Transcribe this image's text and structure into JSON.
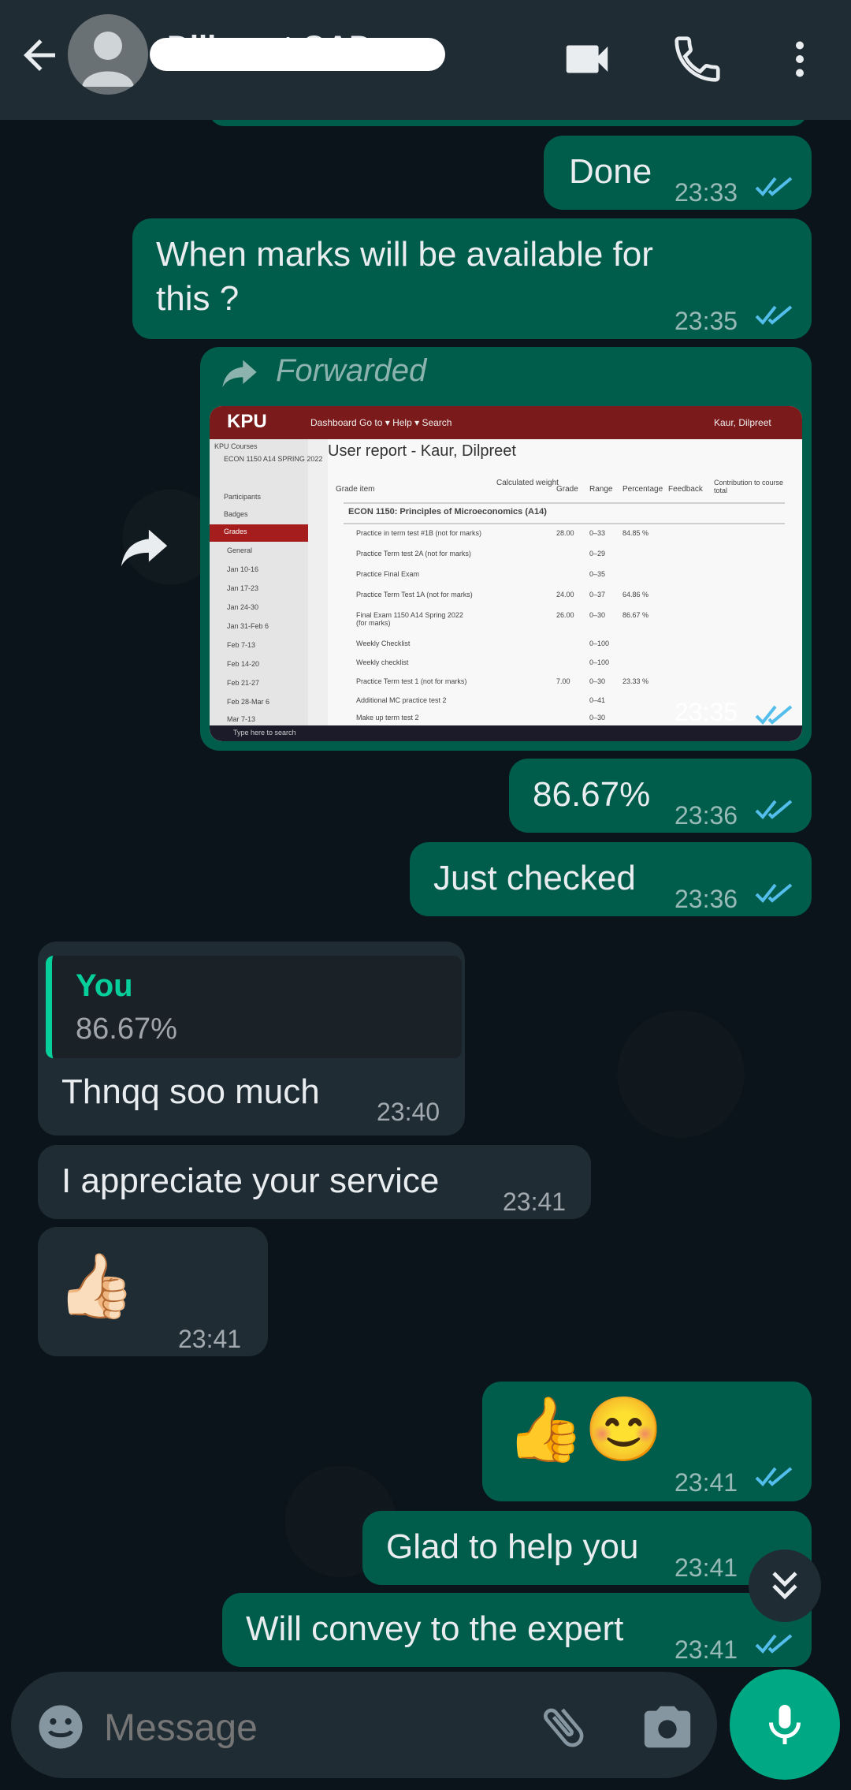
{
  "header": {
    "contact_name": "Diljpreet OAD"
  },
  "messages": [
    {
      "id": "m1",
      "dir": "out",
      "text": "Done",
      "time": "23:33",
      "read": true
    },
    {
      "id": "m2",
      "dir": "out",
      "text_line1": "When marks will be available for",
      "text_line2": "this ?",
      "time": "23:35",
      "read": true
    },
    {
      "id": "m3",
      "dir": "out",
      "type": "image",
      "forwarded_label": "Forwarded",
      "time": "23:35",
      "read": true,
      "image": {
        "brand": "KPU",
        "nav": "Dashboard  Go to ▾  Help ▾  Search",
        "user": "Kaur, Dilpreet",
        "title": "User report - Kaur, Dilpreet",
        "course": "ECON 1150: Principles of Microeconomics (A14)",
        "columns": [
          "Grade item",
          "Calculated weight",
          "Grade",
          "Range",
          "Percentage",
          "Feedback",
          "Contribution to course total"
        ],
        "rows": [
          {
            "item": "Practice in term test #1B (not for marks)",
            "grade": "28.00",
            "range": "0–33",
            "pct": "84.85 %"
          },
          {
            "item": "Practice Term test 2A (not for marks)",
            "grade": "",
            "range": "0–29",
            "pct": ""
          },
          {
            "item": "Practice Final Exam",
            "grade": "",
            "range": "0–35",
            "pct": ""
          },
          {
            "item": "Practice Term Test 1A (not for marks)",
            "grade": "24.00",
            "range": "0–37",
            "pct": "64.86 %"
          },
          {
            "item": "Final Exam 1150 A14 Spring 2022 (for marks)",
            "grade": "26.00",
            "range": "0–30",
            "pct": "86.67 %"
          },
          {
            "item": "Weekly Checklist",
            "grade": "",
            "range": "0–100",
            "pct": ""
          },
          {
            "item": "Weekly checklist",
            "grade": "",
            "range": "0–100",
            "pct": ""
          },
          {
            "item": "Practice Term test 1 (not for marks)",
            "grade": "7.00",
            "range": "0–30",
            "pct": "23.33 %"
          },
          {
            "item": "Additional MC practice test 2",
            "grade": "",
            "range": "0–41",
            "pct": ""
          },
          {
            "item": "Make up term test 2",
            "grade": "",
            "range": "0–30",
            "pct": ""
          }
        ],
        "sidebar": [
          "KPU Courses",
          "ECON 1150 A14 SPRING 2022",
          "Participants",
          "Badges",
          "Grades",
          "General",
          "Jan 10-16",
          "Jan 17-23",
          "Jan 24-30",
          "Jan 31-Feb 6",
          "Feb 7-13",
          "Feb 14-20",
          "Feb 21-27",
          "Feb 28-Mar 6",
          "Mar 7-13"
        ],
        "taskbar_search": "Type here to search"
      }
    },
    {
      "id": "m4",
      "dir": "out",
      "text": "86.67%",
      "time": "23:36",
      "read": true
    },
    {
      "id": "m5",
      "dir": "out",
      "text": "Just checked",
      "time": "23:36",
      "read": true
    },
    {
      "id": "m6",
      "dir": "in",
      "reply_author": "You",
      "reply_text": "86.67%",
      "text": "Thnqq soo much",
      "time": "23:40"
    },
    {
      "id": "m7",
      "dir": "in",
      "text": "I appreciate your service",
      "time": "23:41"
    },
    {
      "id": "m8",
      "dir": "in",
      "emoji": "👍🏻",
      "time": "23:41"
    },
    {
      "id": "m9",
      "dir": "out",
      "emoji": "👍😊",
      "time": "23:41",
      "read": true
    },
    {
      "id": "m10",
      "dir": "out",
      "text": "Glad to help you",
      "time": "23:41",
      "read": true
    },
    {
      "id": "m11",
      "dir": "out",
      "text": "Will convey to the expert",
      "time": "23:41",
      "read": true
    }
  ],
  "composer": {
    "placeholder": "Message"
  },
  "colors": {
    "accent": "#00a884",
    "outgoing_bubble": "#005c4b",
    "incoming_bubble": "#1f2c34",
    "read_ticks": "#53bdeb",
    "header": "#1f2c34"
  },
  "icons": [
    "back-arrow-icon",
    "avatar-placeholder-icon",
    "video-call-icon",
    "phone-icon",
    "more-vert-icon",
    "share-forward-icon",
    "double-check-icon",
    "scroll-down-icon",
    "emoji-icon",
    "attach-icon",
    "camera-icon",
    "mic-icon"
  ]
}
